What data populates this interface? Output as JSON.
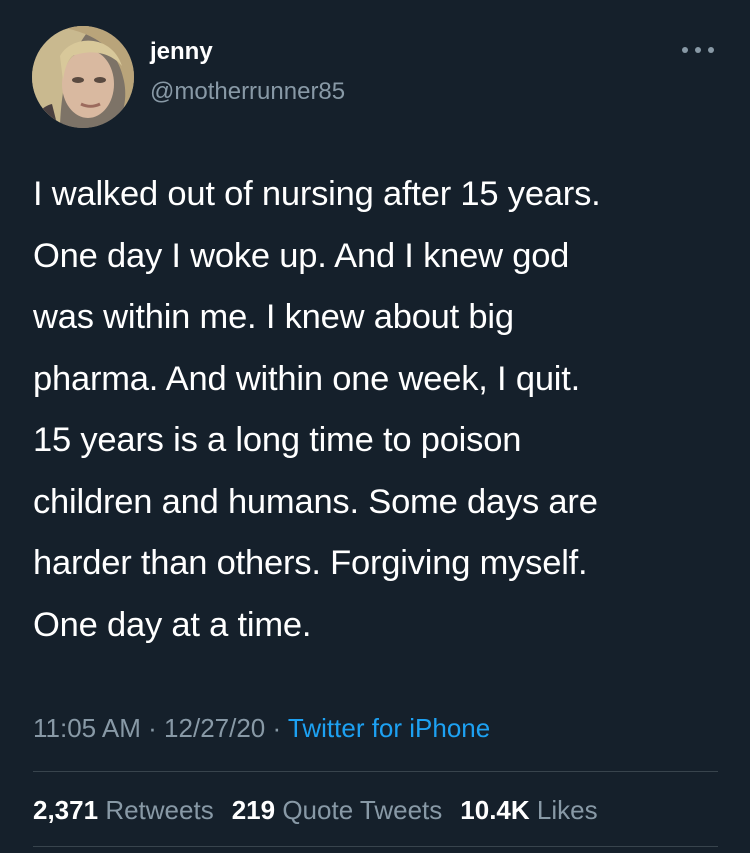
{
  "colors": {
    "background": "#15202b",
    "primary_text": "#ffffff",
    "secondary_text": "#8899a6",
    "link": "#1da1f2",
    "divider": "#38444d"
  },
  "author": {
    "display_name": "jenny",
    "handle": "@motherrunner85",
    "avatar_icon": "profile-photo"
  },
  "more_icon": "more-horizontal-icon",
  "tweet": {
    "lines": [
      "I walked out of nursing after 15 years.",
      "One day I woke up. And I knew god",
      "was within me. I knew about big",
      "pharma. And within one week, I quit.",
      "15 years is a long time to poison",
      "children and humans. Some days are",
      "harder than others. Forgiving myself.",
      "One day at a time."
    ]
  },
  "meta": {
    "time": "11:05 AM",
    "separator": " · ",
    "date": "12/27/20",
    "source": "Twitter for iPhone"
  },
  "stats": {
    "retweets_count": "2,371",
    "retweets_label": "Retweets",
    "quotes_count": "219",
    "quotes_label": "Quote Tweets",
    "likes_count": "10.4K",
    "likes_label": "Likes"
  }
}
